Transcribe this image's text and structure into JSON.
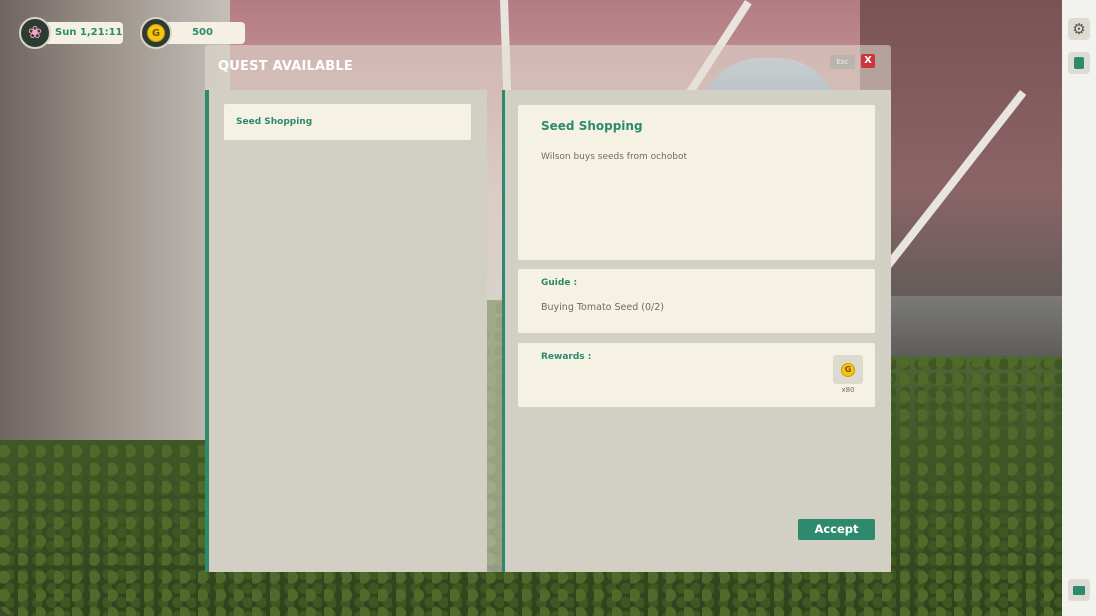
{
  "hud": {
    "datetime": "Sun 1,21:11",
    "gold_amount": "500",
    "gold_icon_letter": "G",
    "flower_icon": "❀"
  },
  "sidebar": {
    "settings_icon": "⚙"
  },
  "quest_window": {
    "title": "QUEST AVAILABLE",
    "esc_label": "Esc",
    "close_label": "X",
    "quest_list": [
      {
        "label": "Seed Shopping"
      }
    ],
    "detail": {
      "title": "Seed Shopping",
      "description": "Wilson buys seeds from ochobot",
      "guide_label": "Guide :",
      "guide_text": "Buying Tomato Seed (0/2)",
      "rewards_label": "Rewards :",
      "rewards": [
        {
          "icon": "gold-coin",
          "icon_letter": "G",
          "quantity": "x80"
        }
      ]
    },
    "accept_label": "Accept"
  },
  "colors": {
    "accent": "#2d8a6c",
    "panel": "#d2cfc5",
    "card": "#f5f1e3",
    "close": "#c9363b",
    "coin": "#f4c519"
  }
}
